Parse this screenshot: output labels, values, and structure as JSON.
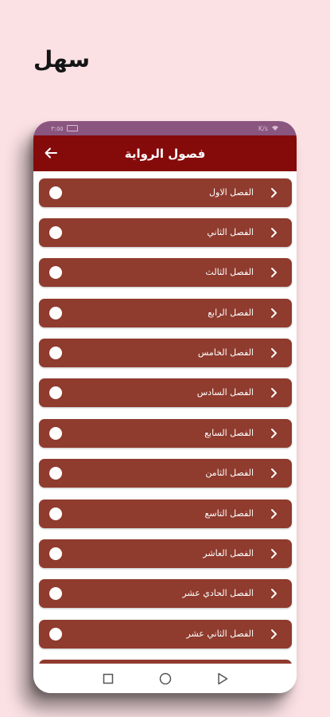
{
  "promo": {
    "title": "سهل"
  },
  "status_bar": {
    "time": "٣:٥٥",
    "speed": "K/s"
  },
  "app_bar": {
    "title": "فصول الرواية",
    "back_icon": "arrow-left-icon"
  },
  "chapters": [
    {
      "label": "الفصل الاول"
    },
    {
      "label": "الفصل الثاني"
    },
    {
      "label": "الفصل الثالث"
    },
    {
      "label": "الفصل الرابع"
    },
    {
      "label": "الفصل الخامس"
    },
    {
      "label": "الفصل السادس"
    },
    {
      "label": "الفصل السابع"
    },
    {
      "label": "الفصل الثامن"
    },
    {
      "label": "الفصل التاسع"
    },
    {
      "label": "الفصل العاشر"
    },
    {
      "label": "الفصل الحادي عشر"
    },
    {
      "label": "الفصل الثاني عشر"
    },
    {
      "label": ""
    }
  ],
  "nav_bar": {
    "icons": [
      "recents-square-icon",
      "home-circle-icon",
      "back-triangle-icon"
    ]
  },
  "colors": {
    "background": "#fbe1e4",
    "status_bar": "#8a5680",
    "app_bar": "#850a0a",
    "chapter_row": "#8f3b2e"
  }
}
